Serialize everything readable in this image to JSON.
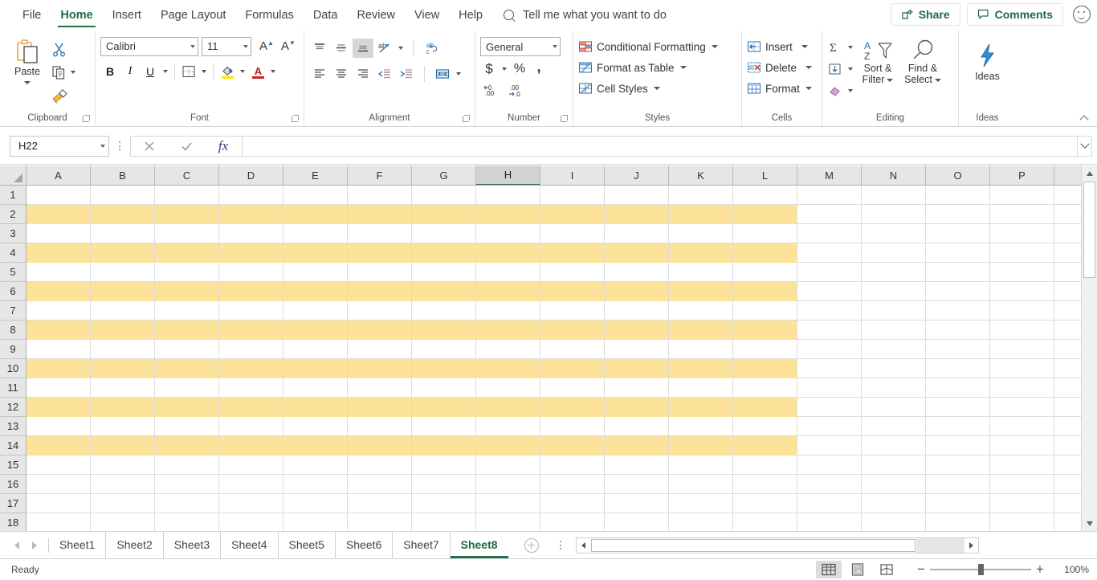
{
  "ribbon_tabs": [
    {
      "label": "File",
      "active": false
    },
    {
      "label": "Home",
      "active": true
    },
    {
      "label": "Insert",
      "active": false
    },
    {
      "label": "Page Layout",
      "active": false
    },
    {
      "label": "Formulas",
      "active": false
    },
    {
      "label": "Data",
      "active": false
    },
    {
      "label": "Review",
      "active": false
    },
    {
      "label": "View",
      "active": false
    },
    {
      "label": "Help",
      "active": false
    }
  ],
  "tell_me": "Tell me what you want to do",
  "topright": {
    "share": "Share",
    "comments": "Comments"
  },
  "groups": {
    "clipboard": {
      "label": "Clipboard",
      "paste": "Paste",
      "cut": "cut-icon",
      "copy": "copy-icon",
      "format_painter": "format-painter-icon"
    },
    "font": {
      "label": "Font",
      "font_name": "Calibri",
      "font_size": "11",
      "grow_font": "A",
      "shrink_font": "A",
      "bold": "B",
      "italic": "I",
      "underline": "U",
      "borders": "borders-icon",
      "fill_color": "fill-color-icon",
      "font_color": "font-color-icon"
    },
    "alignment": {
      "label": "Alignment",
      "top_align": "top-align-icon",
      "middle_align": "middle-align-icon",
      "bottom_align": "bottom-align-icon",
      "orientation": "orientation-icon",
      "wrap_text": "wrap-text-icon",
      "align_left": "align-left-icon",
      "align_center": "align-center-icon",
      "align_right": "align-right-icon",
      "decrease_indent": "decrease-indent-icon",
      "increase_indent": "increase-indent-icon",
      "merge_center": "merge-center-icon"
    },
    "number": {
      "label": "Number",
      "format": "General",
      "accounting": "$",
      "percent": "%",
      "comma": ",",
      "increase_decimal": "increase-decimal-icon",
      "decrease_decimal": "decrease-decimal-icon"
    },
    "styles": {
      "label": "Styles",
      "items": [
        {
          "label": "Conditional Formatting"
        },
        {
          "label": "Format as Table"
        },
        {
          "label": "Cell Styles"
        }
      ]
    },
    "cells": {
      "label": "Cells",
      "items": [
        {
          "label": "Insert"
        },
        {
          "label": "Delete"
        },
        {
          "label": "Format"
        }
      ]
    },
    "editing": {
      "label": "Editing",
      "autosum": "autosum-icon",
      "fill": "fill-icon",
      "clear": "clear-icon",
      "sort_filter_1": "Sort &",
      "sort_filter_2": "Filter",
      "find_select_1": "Find &",
      "find_select_2": "Select"
    },
    "ideas": {
      "label": "Ideas",
      "button": "Ideas"
    }
  },
  "formula_bar": {
    "name_box": "H22",
    "cancel": "cancel-icon",
    "enter": "enter-icon",
    "insert_function": "fx",
    "value": ""
  },
  "grid": {
    "columns": [
      "A",
      "B",
      "C",
      "D",
      "E",
      "F",
      "G",
      "H",
      "I",
      "J",
      "K",
      "L",
      "M",
      "N",
      "O",
      "P"
    ],
    "selected_column": "H",
    "rows": [
      1,
      2,
      3,
      4,
      5,
      6,
      7,
      8,
      9,
      10,
      11,
      12,
      13,
      14,
      15,
      16,
      17,
      18
    ],
    "highlighted_rows": [
      2,
      4,
      6,
      8,
      10,
      12,
      14
    ],
    "highlight_color": "#fde39a",
    "highlight_last_column": "L",
    "cell_values": []
  },
  "sheet_tabs": [
    {
      "label": "Sheet1",
      "active": false
    },
    {
      "label": "Sheet2",
      "active": false
    },
    {
      "label": "Sheet3",
      "active": false
    },
    {
      "label": "Sheet4",
      "active": false
    },
    {
      "label": "Sheet5",
      "active": false
    },
    {
      "label": "Sheet6",
      "active": false
    },
    {
      "label": "Sheet7",
      "active": false
    },
    {
      "label": "Sheet8",
      "active": true
    }
  ],
  "status": {
    "ready": "Ready",
    "view_normal": "normal-view-icon",
    "view_page_layout": "page-layout-view-icon",
    "view_page_break": "page-break-view-icon",
    "zoom_out": "−",
    "zoom_in": "+",
    "zoom_level": "100%"
  },
  "colors": {
    "accent_green": "#217346",
    "highlight_yellow": "#fde39a",
    "header_gray": "#e6e6e6"
  }
}
